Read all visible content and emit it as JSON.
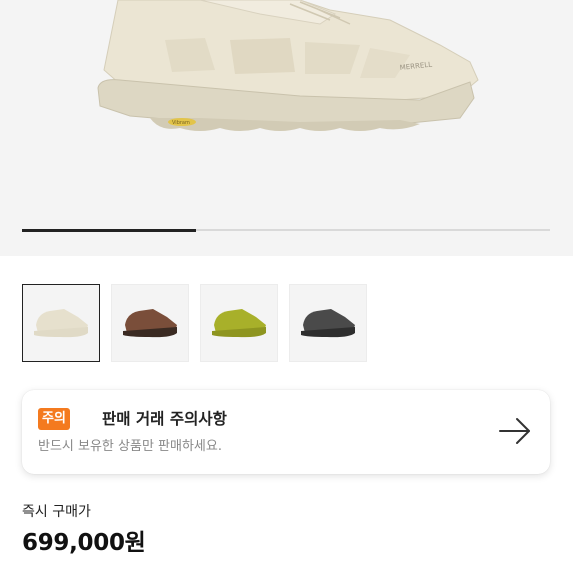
{
  "gallery": {
    "image_position": 0.33,
    "thumbnails": [
      {
        "icon": "shoe-cream-icon",
        "color": "#e6e0cd",
        "sole": "#e0dac6",
        "selected": true
      },
      {
        "icon": "shoe-brown-icon",
        "color": "#7a4e3a",
        "sole": "#3a2a22",
        "selected": false
      },
      {
        "icon": "shoe-lime-icon",
        "color": "#a8b02a",
        "sole": "#8e9520",
        "selected": false
      },
      {
        "icon": "shoe-charcoal-icon",
        "color": "#4a4a4a",
        "sole": "#2e2e2e",
        "selected": false
      }
    ]
  },
  "notice": {
    "badge": "주의",
    "title": "판매 거래 주의사항",
    "subtitle": "반드시 보유한 상품만 판매하세요.",
    "arrow_icon": "arrow-right-icon"
  },
  "price": {
    "label": "즉시 구매가",
    "value": "699,000원"
  },
  "colors": {
    "accent": "#f47a1f",
    "hero_bg": "#f4f4f4"
  }
}
